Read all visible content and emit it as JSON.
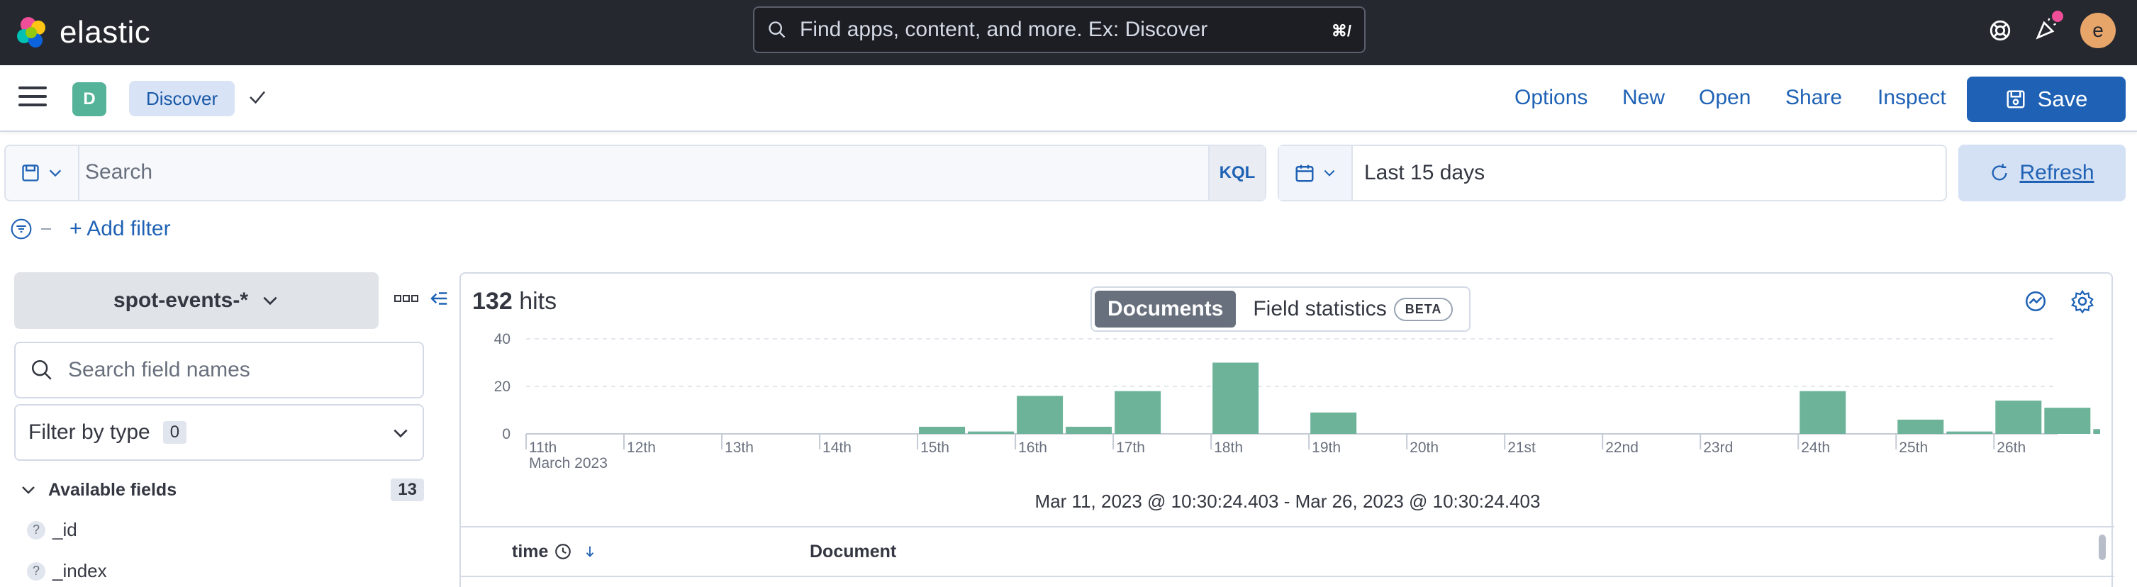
{
  "header": {
    "brand": "elastic",
    "search_placeholder": "Find apps, content, and more. Ex: Discover",
    "search_shortcut": "⌘/",
    "avatar_initial": "e"
  },
  "appbar": {
    "space_initial": "D",
    "breadcrumb": "Discover",
    "nav": [
      "Options",
      "New",
      "Open",
      "Share",
      "Inspect"
    ],
    "save_label": "Save"
  },
  "query": {
    "placeholder": "Search",
    "language": "KQL",
    "time_range": "Last 15 days",
    "refresh_label": "Refresh",
    "add_filter": "+ Add filter"
  },
  "sidebar": {
    "index_pattern": "spot-events-*",
    "field_search_placeholder": "Search field names",
    "filter_by_type": "Filter by type",
    "filter_count": "0",
    "available_label": "Available fields",
    "available_count": "13",
    "fields": [
      "_id",
      "_index"
    ]
  },
  "main": {
    "hits_count": "132",
    "hits_word": "hits",
    "tab_documents": "Documents",
    "tab_field_stats": "Field statistics",
    "beta": "BETA",
    "range_text": "Mar 11, 2023 @ 10:30:24.403 - Mar 26, 2023 @ 10:30:24.403",
    "col_time": "time",
    "col_document": "Document"
  },
  "chart_data": {
    "type": "bar",
    "bar_color": "#6db39a",
    "now_marker_color": "#bd271e",
    "y_ticks": [
      0,
      20,
      40
    ],
    "ylim": [
      0,
      40
    ],
    "x_labels": [
      "11th",
      "12th",
      "13th",
      "14th",
      "15th",
      "16th",
      "17th",
      "18th",
      "19th",
      "20th",
      "21st",
      "22nd",
      "23rd",
      "24th",
      "25th",
      "26th"
    ],
    "x_sublabel": "March 2023",
    "bins_per_day": 2,
    "values": [
      0,
      0,
      0,
      0,
      0,
      0,
      0,
      0,
      3,
      1,
      16,
      3,
      18,
      0,
      30,
      0,
      9,
      0,
      0,
      0,
      0,
      0,
      0,
      0,
      0,
      0,
      18,
      0,
      6,
      1,
      14,
      11,
      2,
      0,
      0,
      0,
      0,
      0,
      0,
      0,
      0,
      0
    ]
  }
}
